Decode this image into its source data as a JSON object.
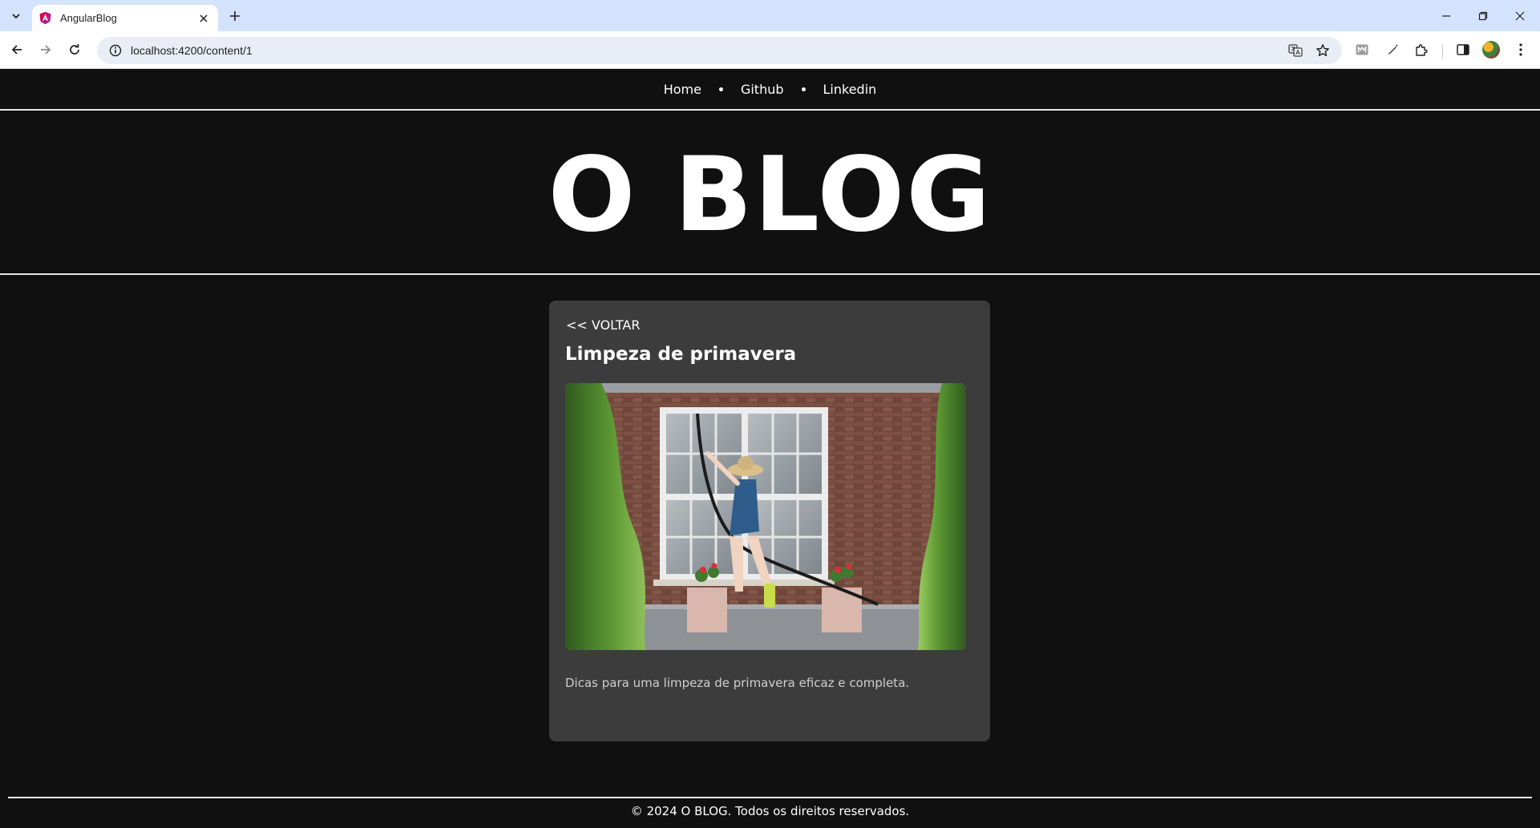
{
  "browser": {
    "tab_title": "AngularBlog",
    "url": "localhost:4200/content/1"
  },
  "site": {
    "nav": [
      {
        "label": "Home"
      },
      {
        "label": "Github"
      },
      {
        "label": "Linkedin"
      }
    ],
    "brand": "O BLOG"
  },
  "post": {
    "back_label": "<< VOLTAR",
    "title": "Limpeza de primavera",
    "description": "Dicas para uma limpeza de primavera eficaz e completa."
  },
  "footer": {
    "text": "© 2024 O BLOG. Todos os direitos reservados."
  }
}
